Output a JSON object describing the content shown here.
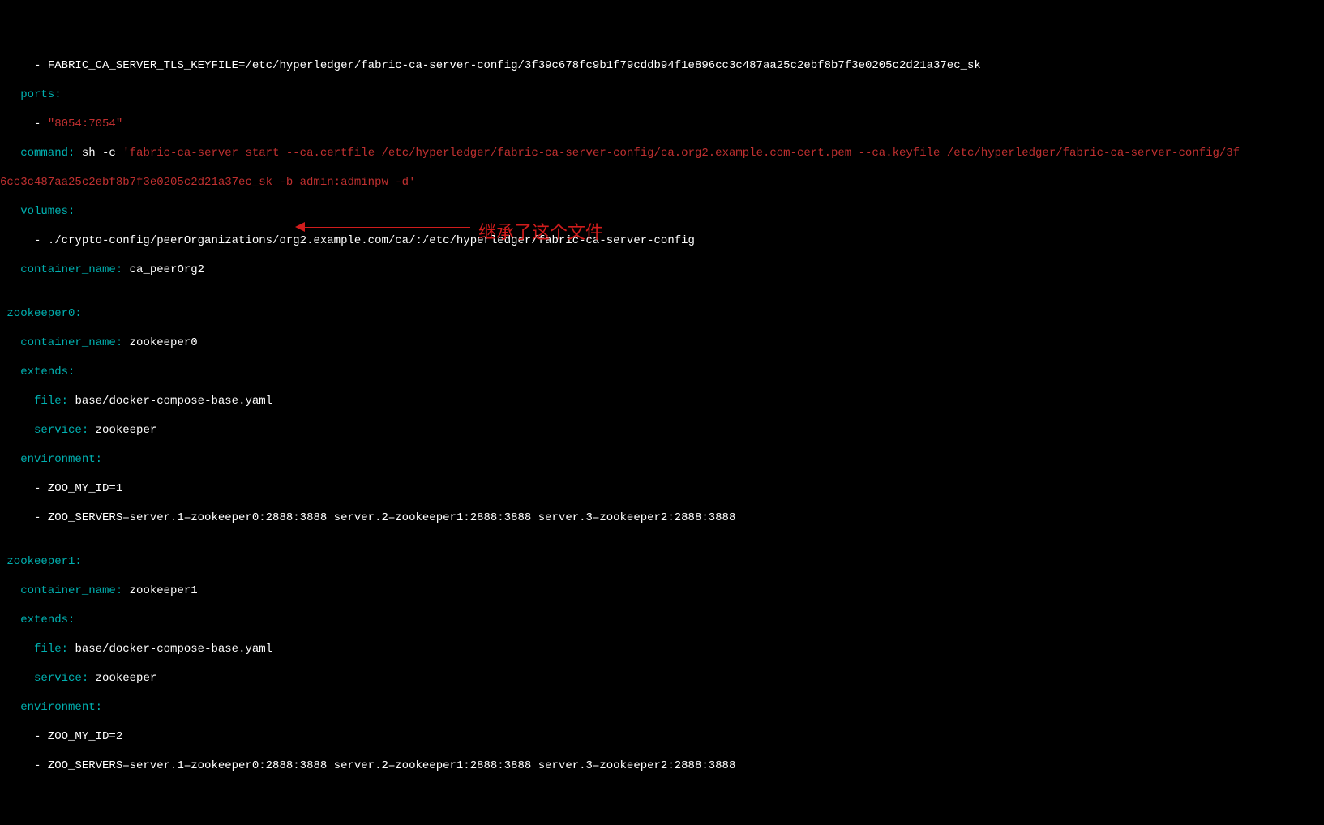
{
  "code": {
    "l1_dash": "     - ",
    "l1_text": "FABRIC_CA_SERVER_TLS_KEYFILE=/etc/hyperledger/fabric-ca-server-config/3f39c678fc9b1f79cddb94f1e896cc3c487aa25c2ebf8b7f3e0205c2d21a37ec_sk",
    "l2_key": "   ports",
    "l2_colon": ":",
    "l3_dash": "     - ",
    "l3_text": "\"8054:7054\"",
    "l4_key": "   command",
    "l4_colon": ": ",
    "l4_cmd": "sh -c ",
    "l4_arg": "'fabric-ca-server start --ca.certfile /etc/hyperledger/fabric-ca-server-config/ca.org2.example.com-cert.pem --ca.keyfile /etc/hyperledger/fabric-ca-server-config/3f",
    "l5_text": "6cc3c487aa25c2ebf8b7f3e0205c2d21a37ec_sk -b admin:adminpw -d'",
    "l6_key": "   volumes",
    "l6_colon": ":",
    "l7_dash": "     - ",
    "l7_text": "./crypto-config/peerOrganizations/org2.example.com/ca/:/etc/hyperledger/fabric-ca-server-config",
    "l8_key": "   container_name",
    "l8_colon": ": ",
    "l8_val": "ca_peerOrg2",
    "l9": "",
    "l10_key": " zookeeper0",
    "l10_colon": ":",
    "l11_key": "   container_name",
    "l11_colon": ": ",
    "l11_val": "zookeeper0",
    "l12_key": "   extends",
    "l12_colon": ":",
    "l13_key": "     file",
    "l13_colon": ": ",
    "l13_val": "base/docker-compose-base.yaml",
    "l14_key": "     service",
    "l14_colon": ": ",
    "l14_val": "zookeeper",
    "l15_key": "   environment",
    "l15_colon": ":",
    "l16_dash": "     - ",
    "l16_text": "ZOO_MY_ID=1",
    "l17_dash": "     - ",
    "l17_text": "ZOO_SERVERS=server.1=zookeeper0:2888:3888 server.2=zookeeper1:2888:3888 server.3=zookeeper2:2888:3888",
    "l18": "",
    "l19_key": " zookeeper1",
    "l19_colon": ":",
    "l20_key": "   container_name",
    "l20_colon": ": ",
    "l20_val": "zookeeper1",
    "l21_key": "   extends",
    "l21_colon": ":",
    "l22_key": "     file",
    "l22_colon": ": ",
    "l22_val": "base/docker-compose-base.yaml",
    "l23_key": "     service",
    "l23_colon": ": ",
    "l23_val": "zookeeper",
    "l24_key": "   environment",
    "l24_colon": ":",
    "l25_dash": "     - ",
    "l25_text": "ZOO_MY_ID=2",
    "l26_dash": "     - ",
    "l26_text": "ZOO_SERVERS=server.1=zookeeper0:2888:3888 server.2=zookeeper1:2888:3888 server.3=zookeeper2:2888:3888"
  },
  "annotation": "继承了这个文件"
}
